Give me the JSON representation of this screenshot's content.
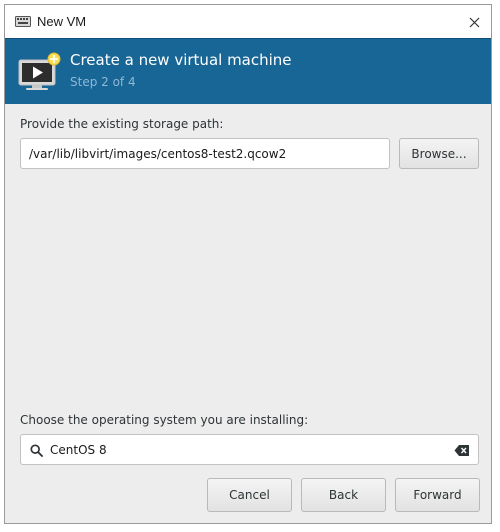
{
  "window": {
    "title": "New VM",
    "icons": {
      "app": "vm-window-icon",
      "close": "close-icon"
    }
  },
  "header": {
    "title": "Create a new virtual machine",
    "step": "Step 2 of 4",
    "icon": "new-vm-monitor-icon",
    "color": "#176696"
  },
  "storage": {
    "label": "Provide the existing storage path:",
    "path_value": "/var/lib/libvirt/images/centos8-test2.qcow2",
    "browse_label": "Browse..."
  },
  "os": {
    "label": "Choose the operating system you are installing:",
    "search_value": "CentOS 8",
    "icons": {
      "search": "search-icon",
      "clear": "clear-text-icon"
    }
  },
  "footer": {
    "cancel_label": "Cancel",
    "back_label": "Back",
    "forward_label": "Forward"
  }
}
